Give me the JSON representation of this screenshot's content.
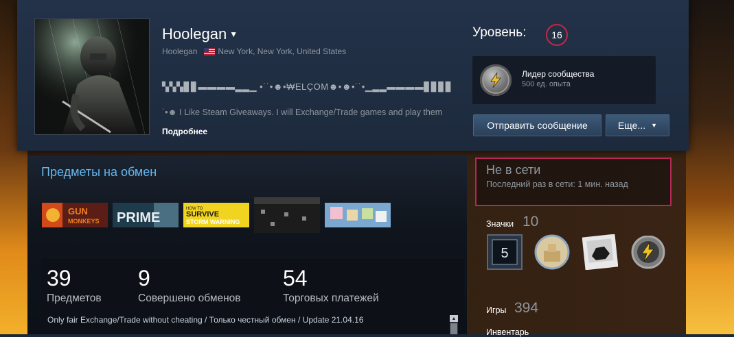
{
  "profile": {
    "persona_name": "Hoolegan",
    "real_name": "Hoolegan",
    "location": "New York, New York, United States",
    "summary_ascii": "▚▚▚▊▊▬▬▬▬▂▂▁ •˙˙•☻•₩ELÇOM☻•☻•˙˙•▁▂▂▬▬▬▬▊▊▊▊",
    "summary_text": "˙•☻ I Like Steam Giveaways. I will Exchange/Trade games and play them",
    "more_link": "Подробнее",
    "level_label": "Уровень:",
    "level_value": "16",
    "featured_badge": {
      "name": "Лидер сообщества",
      "xp": "500 ед. опыта",
      "icon": "lightning-badge-icon"
    },
    "buttons": {
      "send_message": "Отправить сообщение",
      "more": "Еще..."
    }
  },
  "trade_showcase": {
    "title": "Предметы на обмен",
    "items": [
      {
        "name": "Gun Monkeys",
        "label": "GUN MONKEYS",
        "bg": "#5a1e16",
        "fg": "#f08020"
      },
      {
        "name": "Prime",
        "label": "PRIME",
        "bg": "#1d3b4b",
        "fg": "#e8eef2"
      },
      {
        "name": "How to Survive: Storm Warning Edition",
        "label": "SURVIVE STORM WARNING",
        "bg": "#f0d420",
        "fg": "#1a1a1a"
      },
      {
        "name": "",
        "label": "",
        "bg": "#1c1c1c",
        "fg": "#777777"
      },
      {
        "name": "",
        "label": "",
        "bg": "#7aa8d0",
        "fg": "#ffffff"
      }
    ],
    "stats": [
      {
        "value": "39",
        "label": "Предметов"
      },
      {
        "value": "9",
        "label": "Совершено обменов"
      },
      {
        "value": "54",
        "label": "Торговых платежей"
      }
    ],
    "note": "Only fair Exchange/Trade without cheating / Только честный обмен / Update 21.04.16"
  },
  "sidebar": {
    "status_main": "Не в сети",
    "status_sub": "Последний раз в сети: 1 мин. назад",
    "badges_label": "Значки",
    "badges_count": "10",
    "badges": [
      {
        "icon": "level-5-badge-icon",
        "text": "5"
      },
      {
        "icon": "sand-castle-badge-icon"
      },
      {
        "icon": "coal-lump-badge-icon"
      },
      {
        "icon": "lightning-badge-icon"
      }
    ],
    "games_label": "Игры",
    "games_count": "394",
    "inventory_label": "Инвентарь"
  },
  "colors": {
    "accent_blue": "#66b6ef",
    "status_border": "#b5285a",
    "level_ring": "#c02942"
  }
}
